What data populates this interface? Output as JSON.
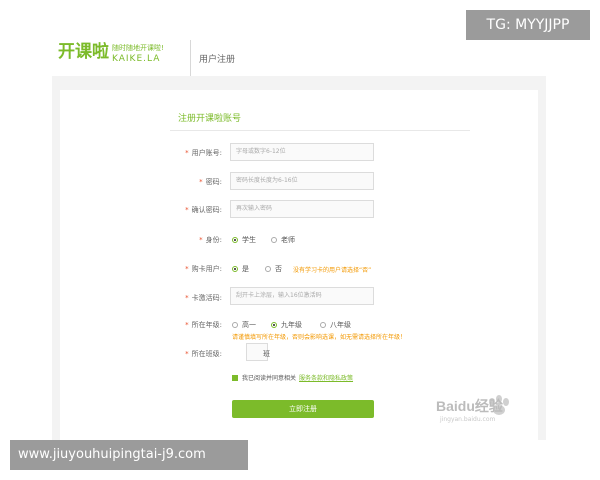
{
  "header": {
    "logo_mark": "开课啦",
    "logo_slogan": "随时随地开课啦!",
    "logo_domain": "KAIKE.LA",
    "title": "用户注册"
  },
  "badge": "TG: MYYJJPP",
  "form": {
    "title": "注册开课啦账号",
    "required_mark": "*",
    "account": {
      "label": "用户账号:",
      "placeholder": "字母或数字6-12位"
    },
    "password": {
      "label": "密码:",
      "placeholder": "密码长度长度为6-16位"
    },
    "confirm": {
      "label": "确认密码:",
      "placeholder": "再次输入密码"
    },
    "identity": {
      "label": "身份:",
      "options": [
        "学生",
        "老师"
      ],
      "selected": "学生"
    },
    "card_user": {
      "label": "购卡用户:",
      "options": [
        "是",
        "否"
      ],
      "selected": "是",
      "hint": "没有学习卡的用户请选择“否”"
    },
    "card_code": {
      "label": "卡激活码:",
      "placeholder": "刮开卡上涂层，输入16位激活码"
    },
    "grade": {
      "label": "所在年级:",
      "options": [
        "高一",
        "九年级",
        "八年级"
      ],
      "selected": "九年级",
      "hint": "请谨慎填写所在年级，否则会影响选课，如无需请选择所在年级！"
    },
    "class": {
      "label": "所在班级:",
      "unit": "班"
    },
    "agree_text": "我已阅读并同意相关",
    "agree_link": "服务条款和隐私政策",
    "submit_label": "立即注册"
  },
  "watermark": {
    "text": "Baidu经验",
    "sub": "jingyan.baidu.com"
  },
  "url_overlay": "www.jiuyouhuipingtai-j9.com",
  "colors": {
    "accent": "#7cbb2a",
    "hint": "#f39800",
    "required": "#e94f2c",
    "overlay": "#9b9b9b"
  }
}
